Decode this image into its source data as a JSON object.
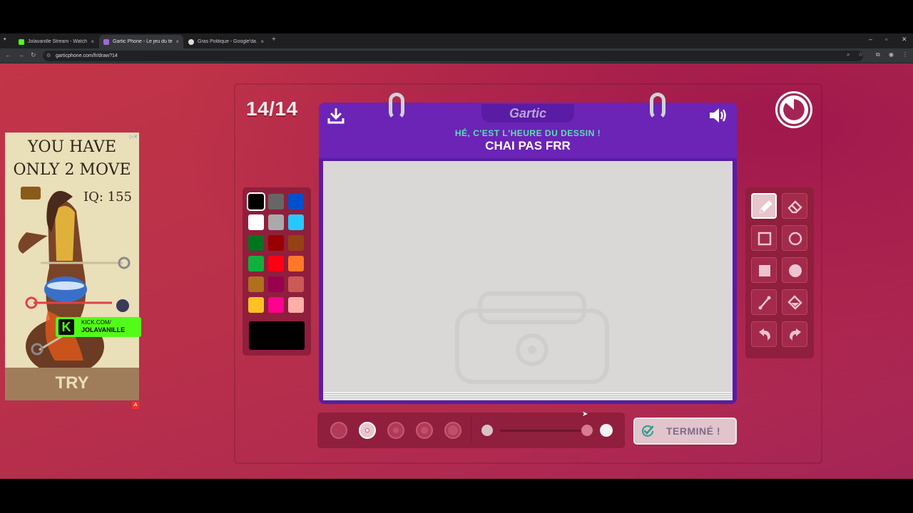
{
  "browser": {
    "tabs": [
      {
        "title": "Jolavanille Stream - Watch Live",
        "favicon_color": "#53fc18",
        "active": false
      },
      {
        "title": "Gartic Phone - Le jeu du téléphone",
        "favicon_color": "#9b6bd6",
        "active": true
      },
      {
        "title": "Gras Politique - Google'da Ara",
        "favicon_color": "#dddddd",
        "active": false
      }
    ],
    "tab_close": "×",
    "new_tab": "+",
    "url": "garticphone.com/fr/draw?14"
  },
  "game": {
    "round_counter": "14/14",
    "logo_text": "Gartic",
    "prompt_sub": "HÉ, C'EST L'HEURE DU DESSIN !",
    "prompt": "CHAI PAS FRR",
    "done_label": "TERMINÉ !",
    "palette": [
      "#000000",
      "#666666",
      "#0050cd",
      "#ffffff",
      "#aaaaaa",
      "#26c9ff",
      "#017420",
      "#990000",
      "#964112",
      "#11b03c",
      "#ff0013",
      "#ff7829",
      "#b0701c",
      "#99004e",
      "#cb5a57",
      "#ffc126",
      "#ff008f",
      "#feafa8"
    ],
    "selected_color": "#000000",
    "selected_tool": "pencil",
    "selected_brush_size": 2
  },
  "ad": {
    "headline_line1": "YOU HAVE",
    "headline_line2": "ONLY 2 MOVE",
    "iq": "IQ: 155",
    "cta": "TRY",
    "kick_line1": "KICK.COM/",
    "kick_line2": "JOLAVANILLE"
  }
}
